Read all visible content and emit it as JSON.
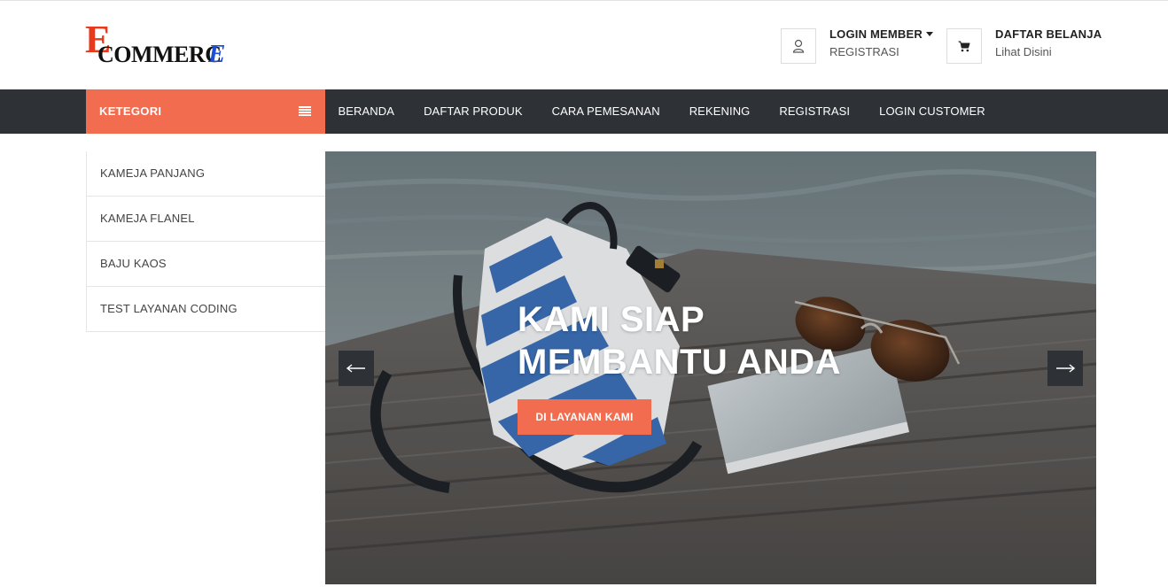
{
  "logo": {
    "first_letter": "E",
    "middle": "COMMERC",
    "last_letter": "E"
  },
  "header": {
    "login": {
      "title": "LOGIN MEMBER",
      "subtitle": "REGISTRASI"
    },
    "cart": {
      "title": "DAFTAR BELANJA",
      "subtitle": "Lihat Disini"
    }
  },
  "nav": {
    "category_label": "KETEGORI",
    "links": [
      "BERANDA",
      "DAFTAR PRODUK",
      "CARA PEMESANAN",
      "REKENING",
      "REGISTRASI",
      "LOGIN CUSTOMER"
    ]
  },
  "categories": [
    "KAMEJA PANJANG",
    "KAMEJA FLANEL",
    "BAJU KAOS",
    "TEST LAYANAN CODING"
  ],
  "hero": {
    "line1": "KAMI SIAP",
    "line2": "MEMBANTU ANDA",
    "button": "DI LAYANAN KAMI",
    "prev": "←",
    "next": "→"
  },
  "colors": {
    "accent": "#f26c4f",
    "nav_bg": "#2e3136",
    "logo_red": "#e8391d",
    "logo_blue": "#1a4fd6"
  },
  "icons": {
    "login": "user-icon",
    "cart": "cart-icon",
    "category_toggle": "menu-icon"
  }
}
